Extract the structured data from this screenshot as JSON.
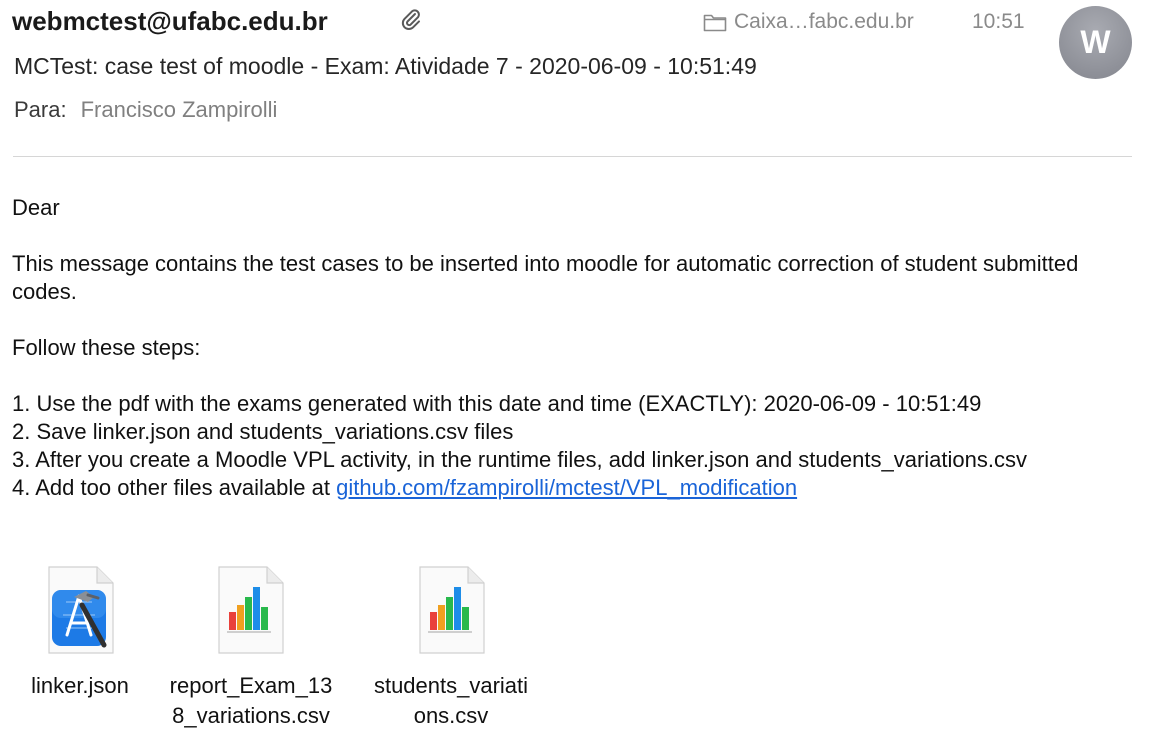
{
  "header": {
    "sender": "webmctest@ufabc.edu.br",
    "mailbox": "Caixa…fabc.edu.br",
    "time": "10:51",
    "avatar_initial": "W",
    "subject": "MCTest: case test of moodle - Exam: Atividade 7 - 2020-06-09 - 10:51:49",
    "to_label": "Para:",
    "to_name": "Francisco Zampirolli"
  },
  "body": {
    "greeting": "Dear",
    "intro": "This message contains the test cases to be inserted into moodle for automatic correction of student submitted codes.",
    "steps_intro": "Follow these steps:",
    "step1": "1. Use the pdf with the exams generated with this date and time (EXACTLY): 2020-06-09 - 10:51:49",
    "step2": "2. Save linker.json and students_variations.csv files",
    "step3": "3. After you create a Moodle VPL activity, in the runtime files, add linker.json and students_variations.csv",
    "step4_prefix": "4. Add too other files available at ",
    "step4_link": "github.com/fzampirolli/mctest/VPL_modification"
  },
  "attachments": [
    {
      "line1": "linker.json",
      "line2": "",
      "icon": "xcode-icon"
    },
    {
      "line1": "report_Exam_13",
      "line2": "8_variations.csv",
      "icon": "numbers-icon"
    },
    {
      "line1": "students_variati",
      "line2": "ons.csv",
      "icon": "numbers-icon"
    }
  ],
  "colors": {
    "link": "#1a64d8",
    "avatar": "#8e9098",
    "secondary_text": "#8a8a8a"
  }
}
